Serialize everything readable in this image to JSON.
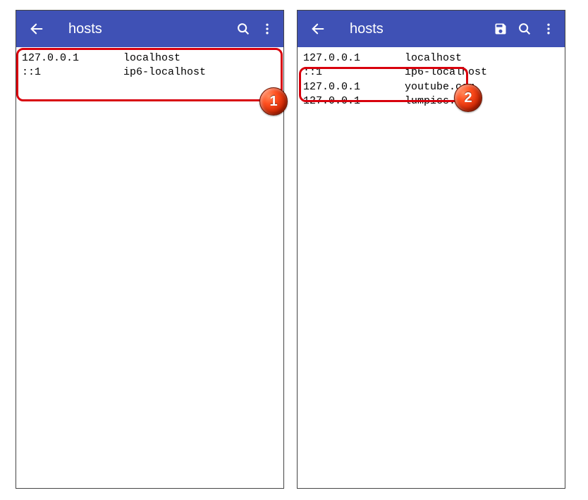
{
  "left": {
    "title": "hosts",
    "lines": [
      "127.0.0.1       localhost",
      "::1             ip6-localhost"
    ],
    "badge": "1"
  },
  "right": {
    "title": "hosts",
    "lines": [
      "127.0.0.1       localhost",
      "::1             ip6-localhost",
      "127.0.0.1       youtube.com",
      "127.0.0.1       lumpics.ru"
    ],
    "badge": "2"
  }
}
